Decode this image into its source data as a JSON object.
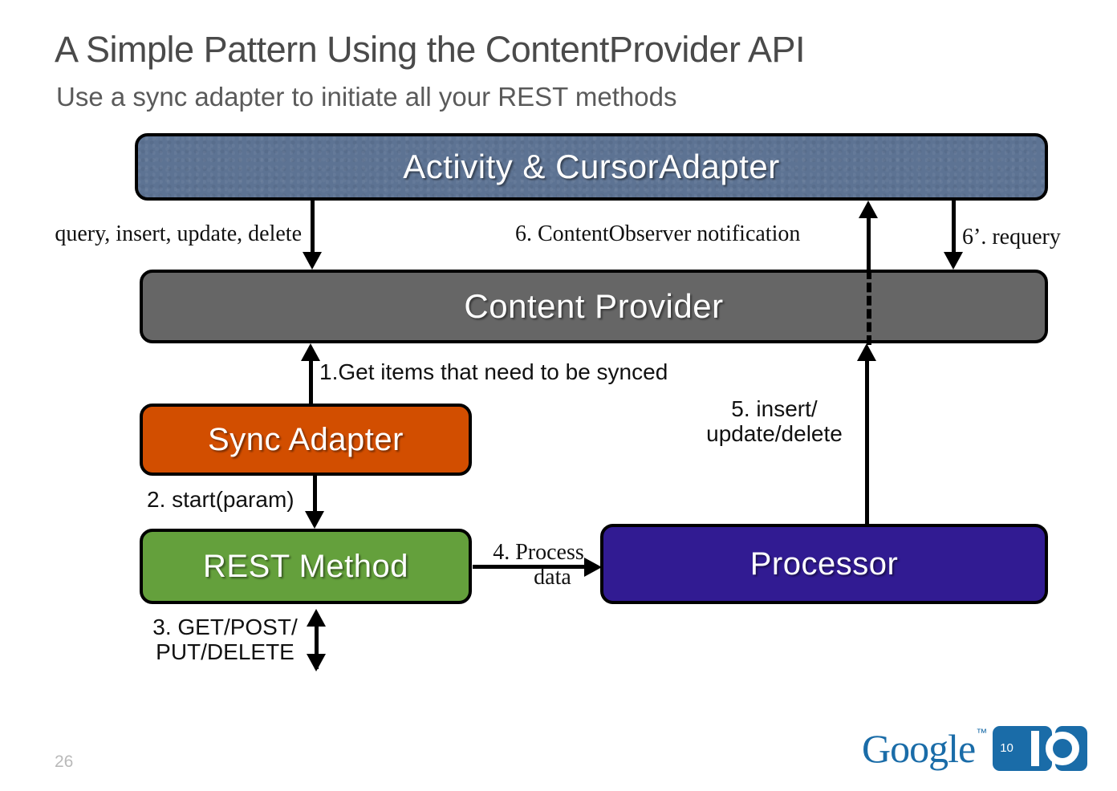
{
  "slide": {
    "title": "A Simple Pattern Using the ContentProvider API",
    "subtitle": "Use a sync adapter to initiate all your REST methods",
    "page_number": "26"
  },
  "nodes": {
    "activity": {
      "label": "Activity & CursorAdapter",
      "color": "#5d7393"
    },
    "content_provider": {
      "label": "Content Provider",
      "color": "#666666"
    },
    "sync_adapter": {
      "label": "Sync Adapter",
      "color": "#d24e00"
    },
    "rest_method": {
      "label": "REST Method",
      "color": "#64a03c"
    },
    "processor": {
      "label": "Processor",
      "color": "#311b92"
    }
  },
  "edges": {
    "query": "query, insert, update, delete",
    "observer": "6. ContentObserver notification",
    "requery": "6’. requery",
    "get_items": "1.Get items that need to be synced",
    "start_param": "2. start(param)",
    "http_verbs": "3. GET/POST/\nPUT/DELETE",
    "process_data": "4. Process\n     data",
    "insert_update_delete": "5. insert/\nupdate/delete"
  },
  "footer": {
    "google_wordmark": "Google",
    "trademark": "™",
    "year_badge": "10",
    "io_letters": "I O",
    "brand_color": "#1a6ca8"
  }
}
